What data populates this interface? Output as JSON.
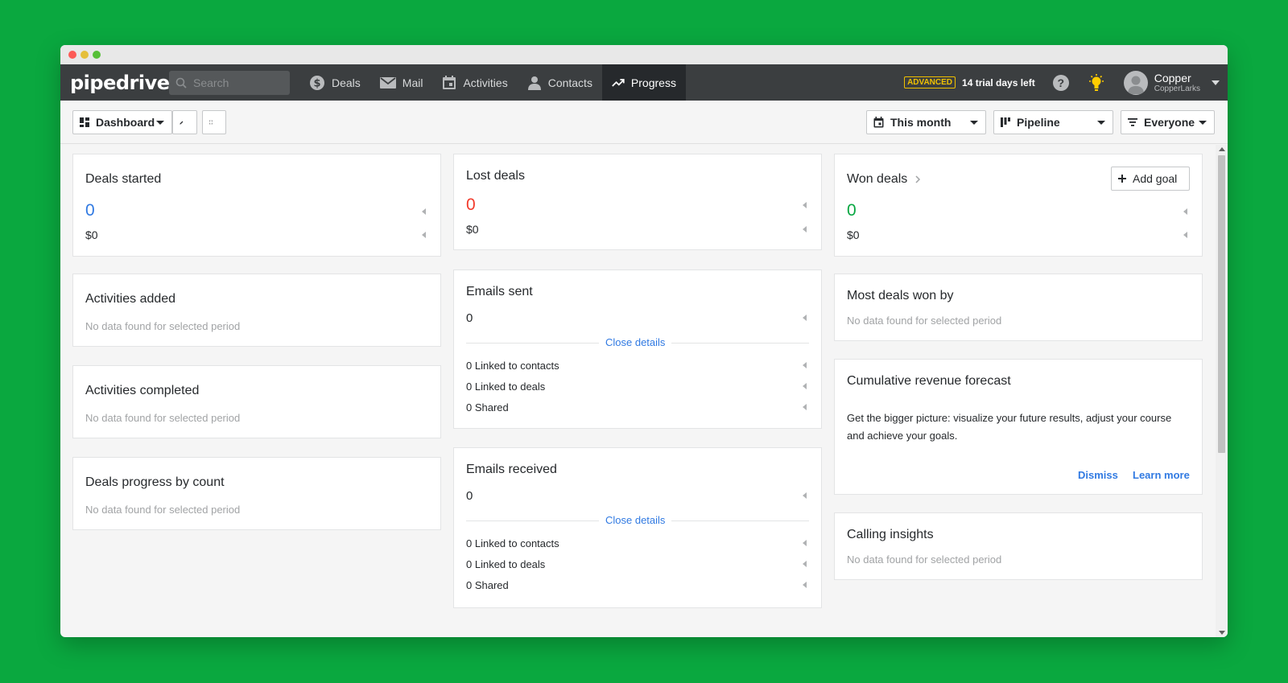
{
  "nav": {
    "logo": "pipedrive",
    "search_placeholder": "Search",
    "items": [
      {
        "label": "Deals",
        "icon": "dollar-icon"
      },
      {
        "label": "Mail",
        "icon": "mail-icon"
      },
      {
        "label": "Activities",
        "icon": "calendar-icon"
      },
      {
        "label": "Contacts",
        "icon": "person-icon"
      },
      {
        "label": "Progress",
        "icon": "trend-icon",
        "active": true
      }
    ],
    "badge": "ADVANCED",
    "trial": "14 trial days left",
    "help": "?",
    "user_name": "Copper",
    "user_company": "CopperLarks"
  },
  "toolbar": {
    "dashboard_label": "Dashboard",
    "period_label": "This month",
    "pipeline_label": "Pipeline",
    "owner_label": "Everyone"
  },
  "cards": {
    "deals_started": {
      "title": "Deals started",
      "count": "0",
      "amount": "$0"
    },
    "activities_added": {
      "title": "Activities added",
      "nodata": "No data found for selected period"
    },
    "activities_completed": {
      "title": "Activities completed",
      "nodata": "No data found for selected period"
    },
    "deals_progress": {
      "title": "Deals progress by count",
      "nodata": "No data found for selected period"
    },
    "lost_deals": {
      "title": "Lost deals",
      "count": "0",
      "amount": "$0"
    },
    "emails_sent": {
      "title": "Emails sent",
      "count": "0",
      "close": "Close details",
      "rows": [
        "0 Linked to contacts",
        "0 Linked to deals",
        "0 Shared"
      ]
    },
    "emails_received": {
      "title": "Emails received",
      "count": "0",
      "close": "Close details",
      "rows": [
        "0 Linked to contacts",
        "0 Linked to deals",
        "0 Shared"
      ]
    },
    "won_deals": {
      "title": "Won deals",
      "count": "0",
      "amount": "$0",
      "add_goal": "Add goal"
    },
    "most_won": {
      "title": "Most deals won by",
      "nodata": "No data found for selected period"
    },
    "forecast": {
      "title": "Cumulative revenue forecast",
      "text": "Get the bigger picture: visualize your future results, adjust your course and achieve your goals.",
      "dismiss": "Dismiss",
      "learn": "Learn more"
    },
    "calling": {
      "title": "Calling insights",
      "nodata": "No data found for selected period"
    }
  },
  "colors": {
    "blue": "#317ae2",
    "red": "#f23b2c",
    "green": "#08a742",
    "nav_bg": "#3b3e40"
  }
}
